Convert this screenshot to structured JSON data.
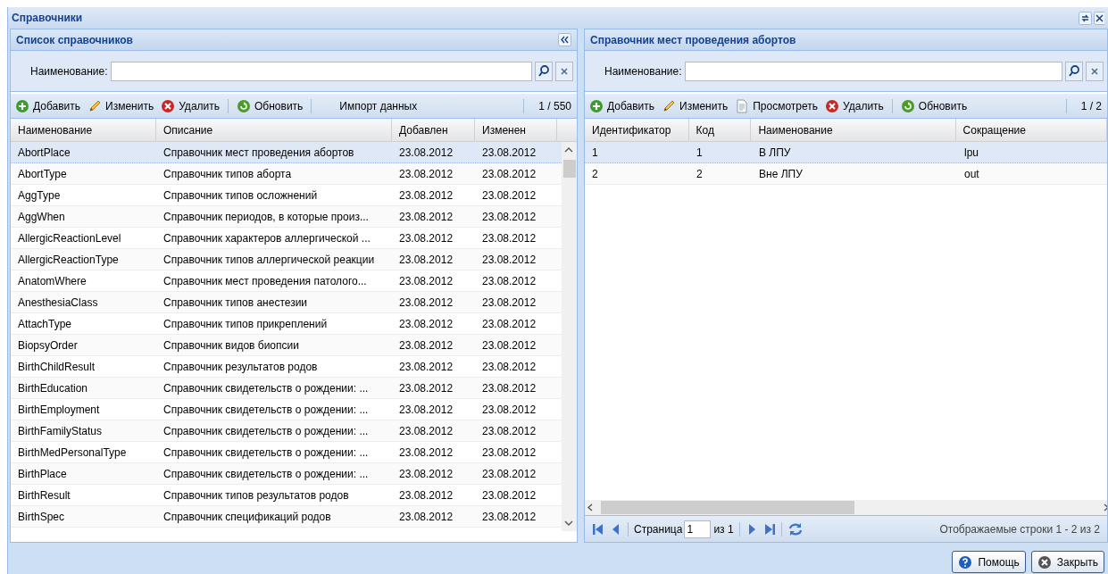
{
  "window": {
    "title": "Справочники"
  },
  "left_panel": {
    "title": "Список справочников",
    "search": {
      "label": "Наименование:"
    },
    "toolbar": {
      "buttons": [
        {
          "kind": "add",
          "label": "Добавить"
        },
        {
          "kind": "edit",
          "label": "Изменить"
        },
        {
          "kind": "delete",
          "label": "Удалить"
        },
        {
          "kind": "refresh",
          "label": "Обновить"
        },
        {
          "kind": "plain",
          "label": "Импорт данных"
        }
      ],
      "count": "1 / 550"
    },
    "columns": [
      "Наименование",
      "Описание",
      "Добавлен",
      "Изменен"
    ],
    "rows": [
      {
        "selected": true,
        "cells": [
          "AbortPlace",
          "Справочник мест проведения абортов",
          "23.08.2012",
          "23.08.2012"
        ]
      },
      {
        "selected": false,
        "cells": [
          "AbortType",
          "Справочник типов аборта",
          "23.08.2012",
          "23.08.2012"
        ]
      },
      {
        "selected": false,
        "cells": [
          "AggType",
          "Справочник типов осложнений",
          "23.08.2012",
          "23.08.2012"
        ]
      },
      {
        "selected": false,
        "cells": [
          "AggWhen",
          "Справочник периодов, в которые произ...",
          "23.08.2012",
          "23.08.2012"
        ]
      },
      {
        "selected": false,
        "cells": [
          "AllergicReactionLevel",
          "Справочник характеров аллергической ...",
          "23.08.2012",
          "23.08.2012"
        ]
      },
      {
        "selected": false,
        "cells": [
          "AllergicReactionType",
          "Справочник типов аллергической реакции",
          "23.08.2012",
          "23.08.2012"
        ]
      },
      {
        "selected": false,
        "cells": [
          "AnatomWhere",
          "Справочник мест проведения патолого...",
          "23.08.2012",
          "23.08.2012"
        ]
      },
      {
        "selected": false,
        "cells": [
          "AnesthesiaClass",
          "Справочник типов анестезии",
          "23.08.2012",
          "23.08.2012"
        ]
      },
      {
        "selected": false,
        "cells": [
          "AttachType",
          "Справочник типов прикреплений",
          "23.08.2012",
          "23.08.2012"
        ]
      },
      {
        "selected": false,
        "cells": [
          "BiopsyOrder",
          "Справочник видов биопсии",
          "23.08.2012",
          "23.08.2012"
        ]
      },
      {
        "selected": false,
        "cells": [
          "BirthChildResult",
          "Справочник результатов родов",
          "23.08.2012",
          "23.08.2012"
        ]
      },
      {
        "selected": false,
        "cells": [
          "BirthEducation",
          "Справочник свидетельств о рождении: ...",
          "23.08.2012",
          "23.08.2012"
        ]
      },
      {
        "selected": false,
        "cells": [
          "BirthEmployment",
          "Справочник свидетельств о рождении: ...",
          "23.08.2012",
          "23.08.2012"
        ]
      },
      {
        "selected": false,
        "cells": [
          "BirthFamilyStatus",
          "Справочник свидетельств о рождении: ...",
          "23.08.2012",
          "23.08.2012"
        ]
      },
      {
        "selected": false,
        "cells": [
          "BirthMedPersonalType",
          "Справочник свидетельств о рождении: ...",
          "23.08.2012",
          "23.08.2012"
        ]
      },
      {
        "selected": false,
        "cells": [
          "BirthPlace",
          "Справочник свидетельств о рождении: ...",
          "23.08.2012",
          "23.08.2012"
        ]
      },
      {
        "selected": false,
        "cells": [
          "BirthResult",
          "Справочник типов результатов родов",
          "23.08.2012",
          "23.08.2012"
        ]
      },
      {
        "selected": false,
        "cells": [
          "BirthSpec",
          "Справочник спецификаций родов",
          "23.08.2012",
          "23.08.2012"
        ]
      }
    ]
  },
  "right_panel": {
    "title": "Справочник мест проведения абортов",
    "search": {
      "label": "Наименование:"
    },
    "toolbar": {
      "buttons": [
        {
          "kind": "add",
          "label": "Добавить"
        },
        {
          "kind": "edit",
          "label": "Изменить"
        },
        {
          "kind": "view",
          "label": "Просмотреть"
        },
        {
          "kind": "delete",
          "label": "Удалить"
        },
        {
          "kind": "refresh",
          "label": "Обновить"
        }
      ],
      "count": "1 / 2"
    },
    "columns": [
      "Идентификатор",
      "Код",
      "Наименование",
      "Сокращение"
    ],
    "rows": [
      {
        "selected": true,
        "cells": [
          "1",
          "1",
          "В ЛПУ",
          "lpu"
        ]
      },
      {
        "selected": false,
        "cells": [
          "2",
          "2",
          "Вне ЛПУ",
          "out"
        ]
      }
    ],
    "pager": {
      "page_label": "Страница",
      "page_value": "1",
      "page_total": "из 1",
      "status": "Отображаемые строки 1 - 2 из 2"
    }
  },
  "footer_buttons": [
    {
      "kind": "help",
      "label": "Помощь"
    },
    {
      "kind": "close",
      "label": "Закрыть"
    }
  ]
}
